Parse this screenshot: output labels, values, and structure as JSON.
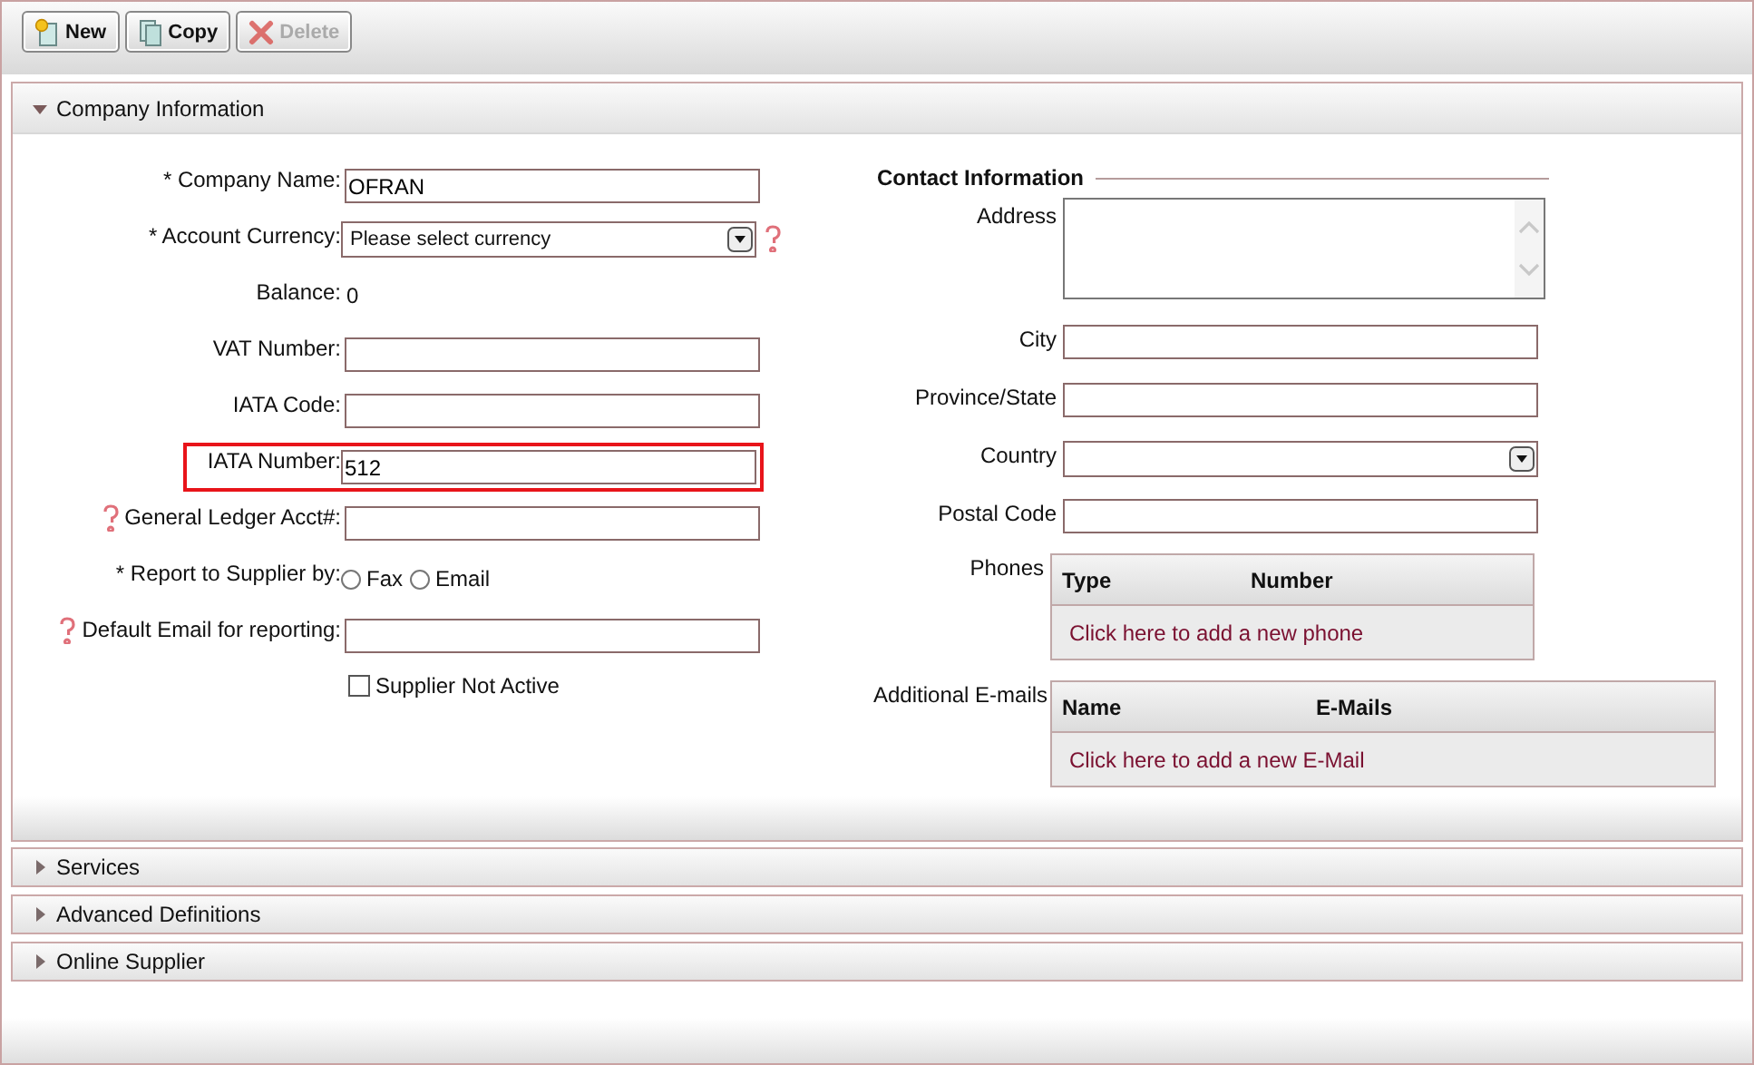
{
  "toolbar": {
    "buttons": [
      {
        "label": "New",
        "kind": "new",
        "disabled": false
      },
      {
        "label": "Copy",
        "kind": "copy",
        "disabled": false
      },
      {
        "label": "Delete",
        "kind": "delete",
        "disabled": true
      }
    ]
  },
  "sections": [
    {
      "title": "Company Information",
      "expanded": true,
      "fields": [
        {
          "kind": "text",
          "label": "* Company Name:",
          "value": "OFRAN",
          "highlighted": false
        },
        {
          "kind": "select",
          "label": "* Account Currency:",
          "value": "Please select currency",
          "help_after": true
        },
        {
          "kind": "static",
          "label": "Balance:",
          "value": "0"
        },
        {
          "kind": "text",
          "label": "VAT Number:",
          "highlighted": false
        },
        {
          "kind": "text",
          "label": "IATA Code:",
          "highlighted": false
        },
        {
          "kind": "text",
          "label": "IATA Number:",
          "value": "512",
          "highlighted": true
        },
        {
          "kind": "text",
          "label": "General Ledger Acct#:",
          "help_before": true,
          "highlighted": false
        },
        {
          "kind": "radio",
          "label": "* Report to Supplier by:",
          "options": [
            {
              "label": "Fax",
              "selected": false
            },
            {
              "label": "Email",
              "selected": false
            }
          ]
        },
        {
          "kind": "text",
          "label": "Default Email for reporting:",
          "help_before": true,
          "highlighted": false
        },
        {
          "kind": "checkbox",
          "label": "Supplier Not Active",
          "checked": false
        }
      ],
      "contact": {
        "title": "Contact Information",
        "fields": [
          {
            "kind": "textarea",
            "label": "Address"
          },
          {
            "kind": "text",
            "label": "City"
          },
          {
            "kind": "text",
            "label": "Province/State"
          },
          {
            "kind": "select",
            "label": "Country"
          },
          {
            "kind": "text",
            "label": "Postal Code"
          }
        ],
        "tables": [
          {
            "kind": "narrow",
            "label": "Phones",
            "columns": [
              "Type",
              "Number"
            ],
            "add_link": "Click here to add a new phone"
          },
          {
            "kind": "wide",
            "label": "Additional E-mails",
            "columns": [
              "Name",
              "E-Mails"
            ],
            "add_link": "Click here to add a new E-Mail"
          }
        ]
      }
    },
    {
      "title": "Services",
      "expanded": false
    },
    {
      "title": "Advanced Definitions",
      "expanded": false
    },
    {
      "title": "Online Supplier",
      "expanded": false
    }
  ]
}
